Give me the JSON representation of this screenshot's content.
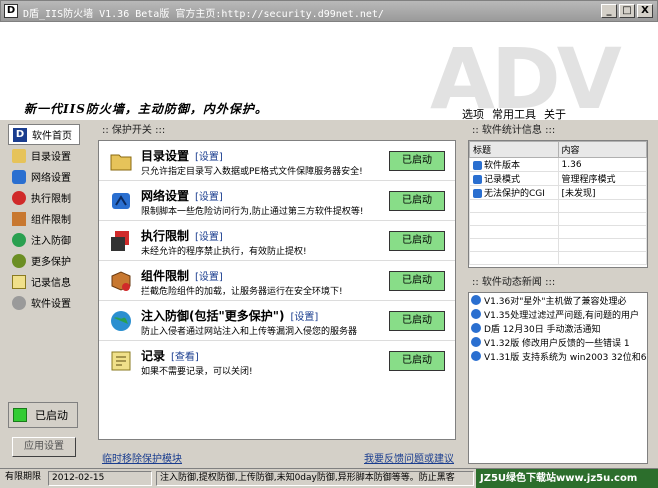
{
  "window": {
    "title": "D盾_IIS防火墙  V1.36 Beta版   官方主页:http://security.d99net.net/",
    "minimize": "_",
    "maximize": "□",
    "close": "X"
  },
  "banner": {
    "watermark_text": "ADV",
    "slogan": "新一代IIS防火墙，主动防御，内外保护。",
    "menu": [
      "选项",
      "常用工具",
      "关于"
    ]
  },
  "sidebar": {
    "items": [
      {
        "label": "软件首页",
        "icon": "d-logo-icon"
      },
      {
        "label": "目录设置",
        "icon": "folder-icon"
      },
      {
        "label": "网络设置",
        "icon": "network-icon"
      },
      {
        "label": "执行限制",
        "icon": "execute-icon"
      },
      {
        "label": "组件限制",
        "icon": "component-icon"
      },
      {
        "label": "注入防御",
        "icon": "globe-icon"
      },
      {
        "label": "更多保护",
        "icon": "more-icon"
      },
      {
        "label": "记录信息",
        "icon": "log-icon"
      },
      {
        "label": "软件设置",
        "icon": "gear-icon"
      }
    ],
    "status_label": "已启动",
    "apply_label": "应用设置"
  },
  "main": {
    "section_title": ":: 保护开关 :::",
    "modules": [
      {
        "title": "目录设置",
        "link": "[设置]",
        "desc": "只允许指定目录写入数据或PE格式文件保障服务器安全!",
        "button": "已启动"
      },
      {
        "title": "网络设置",
        "link": "[设置]",
        "desc": "限制脚本一些危险访问行为,防止通过第三方软件提权等!",
        "button": "已启动"
      },
      {
        "title": "执行限制",
        "link": "[设置]",
        "desc": "未经允许的程序禁止执行，有效防止提权!",
        "button": "已启动"
      },
      {
        "title": "组件限制",
        "link": "[设置]",
        "desc": "拦截危险组件的加载，让服务器运行在安全环境下!",
        "button": "已启动"
      },
      {
        "title": "注入防御(包括\"更多保护\")",
        "link": "[设置]",
        "desc": "防止入侵者通过网站注入和上传等漏洞入侵您的服务器",
        "button": "已启动"
      },
      {
        "title": "记录",
        "link": "[查看]",
        "desc": "如果不需要记录，可以关闭!",
        "button": "已启动"
      }
    ],
    "link_left": "临时移除保护模块",
    "link_right": "我要反馈问题或建议"
  },
  "stats": {
    "section_title": ":: 软件统计信息 :::",
    "headers": [
      "标题",
      "内容"
    ],
    "rows": [
      [
        "软件版本",
        "1.36"
      ],
      [
        "记录模式",
        "管理程序模式"
      ],
      [
        "无法保护的CGI",
        "[未发现]"
      ]
    ]
  },
  "news": {
    "section_title": ":: 软件动态新闻 :::",
    "items": [
      "V1.36对\"星外\"主机做了兼容处理必",
      "V1.35处理过滤过严问题,有问题的用户",
      "D盾 12月30日 手动激活通知",
      "V1.32版 修改用户反馈的一些错误 1",
      "V1.31版 支持系统为 win2003 32位和6"
    ]
  },
  "statusbar": {
    "label": "有限期限",
    "date": "2012-02-15",
    "ticker": "注入防御,提权防御,上传防御,未知0day防御,异形脚本防御等等。防止黑客",
    "watermark": "JZ5U绿色下载站www.jz5u.com"
  }
}
